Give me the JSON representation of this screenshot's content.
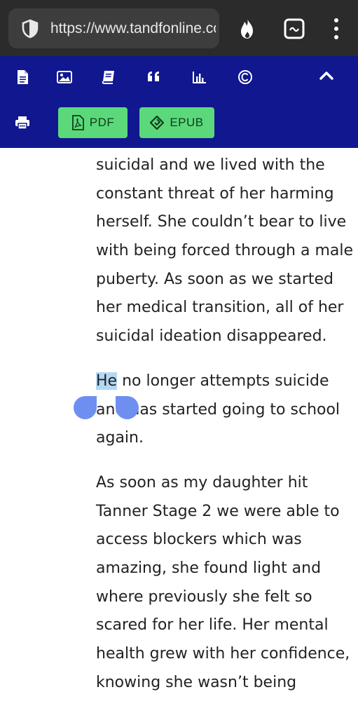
{
  "browser": {
    "url": "https://www.tandfonline.com",
    "icons": [
      "shield-icon",
      "flame-icon",
      "tab-switcher-icon",
      "more-vert-icon"
    ]
  },
  "toolbar": {
    "icons": [
      "article-icon",
      "figures-icon",
      "references-icon",
      "citation-icon",
      "metrics-icon",
      "copyright-icon",
      "collapse-icon",
      "print-icon"
    ],
    "pdf_label": "PDF",
    "epub_label": "EPUB",
    "background": "#10178f",
    "button_color": "#5bd97a"
  },
  "article": {
    "p1": [
      "suicidal and we lived with the",
      "constant threat of her harming",
      "herself. She couldn’t bear to live",
      "with being forced through a male",
      "puberty. As soon as we started",
      "her medical transition, all of her",
      "suicidal ideation disappeared."
    ],
    "p2_selected": "He",
    "p2_line1_rest": " no longer attempts suicide",
    "p2_line2": "and has started going to school",
    "p2_line3": "again.",
    "p3": [
      "As soon as my daughter hit",
      "Tanner Stage 2 we were able to",
      "access blockers which was",
      "amazing, she found light and",
      "where previously she felt so",
      "scared for her life. Her mental",
      "health grew with her confidence,",
      "knowing she wasn’t being"
    ]
  }
}
